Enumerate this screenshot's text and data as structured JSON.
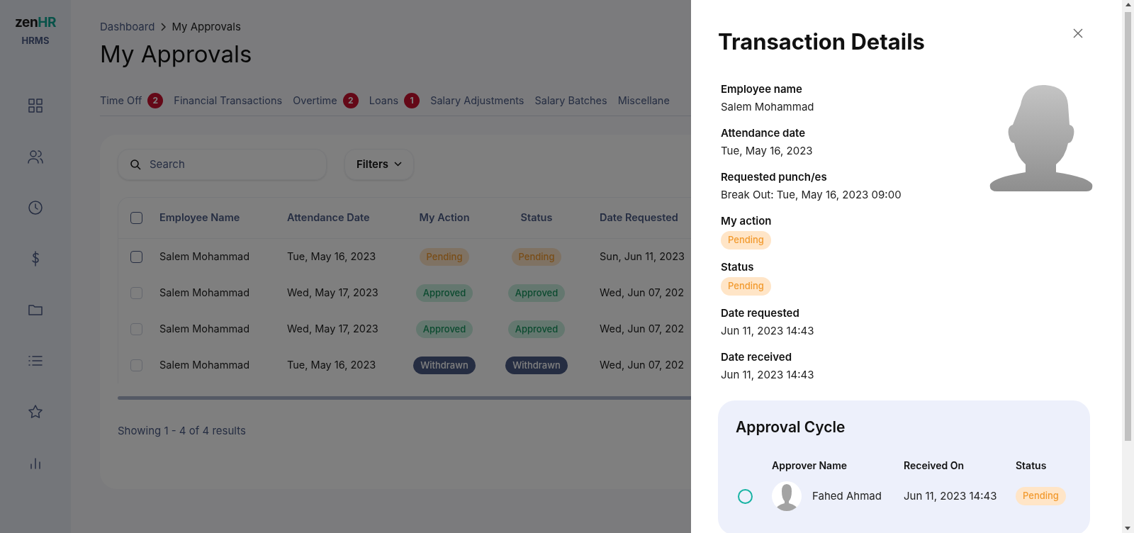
{
  "logo": {
    "brand_left": "zen",
    "brand_right": "HR",
    "product": "HRMS"
  },
  "sidebar": {
    "items": [
      {
        "kind": "grid"
      },
      {
        "kind": "users"
      },
      {
        "kind": "clock"
      },
      {
        "kind": "dollar"
      },
      {
        "kind": "folder"
      },
      {
        "kind": "list"
      },
      {
        "kind": "star"
      },
      {
        "kind": "chart"
      }
    ]
  },
  "breadcrumb": [
    "Dashboard",
    "My Approvals"
  ],
  "title": "My Approvals",
  "tabs": [
    {
      "label": "Time Off",
      "count": "2",
      "selected": false
    },
    {
      "label": "Financial Transactions",
      "selected": false
    },
    {
      "label": "Overtime",
      "count": "2",
      "selected": false
    },
    {
      "label": "Loans",
      "count": "1",
      "selected": false
    },
    {
      "label": "Salary Adjustments",
      "selected": false
    },
    {
      "label": "Salary Batches",
      "selected": false
    },
    {
      "label": "Miscellane",
      "selected": false
    }
  ],
  "search": {
    "placeholder": "Search"
  },
  "filters_button": "Filters",
  "table": {
    "select_all_checked": false,
    "columns": [
      "Employee Name",
      "Attendance Date",
      "My Action",
      "Status",
      "Date Requested"
    ],
    "rows": [
      {
        "disabled": false,
        "checked": false,
        "employee": "Salem Mohammad",
        "date": "Tue, May 16, 2023",
        "my_action": {
          "kind": "pending",
          "label": "Pending"
        },
        "status": {
          "kind": "pending",
          "label": "Pending"
        },
        "requested": "Sun, Jun 11, 2023"
      },
      {
        "disabled": true,
        "checked": false,
        "employee": "Salem Mohammad",
        "date": "Wed, May 17, 2023",
        "my_action": {
          "kind": "approved",
          "label": "Approved"
        },
        "status": {
          "kind": "approved",
          "label": "Approved"
        },
        "requested": "Wed, Jun 07, 202"
      },
      {
        "disabled": true,
        "checked": false,
        "employee": "Salem Mohammad",
        "date": "Wed, May 17, 2023",
        "my_action": {
          "kind": "approved",
          "label": "Approved"
        },
        "status": {
          "kind": "approved",
          "label": "Approved"
        },
        "requested": "Wed, Jun 07, 202"
      },
      {
        "disabled": true,
        "checked": false,
        "employee": "Salem Mohammad",
        "date": "Tue, May 16, 2023",
        "my_action": {
          "kind": "withdrawn",
          "label": "Withdrawn"
        },
        "status": {
          "kind": "withdrawn",
          "label": "Withdrawn"
        },
        "requested": "Wed, Jun 07, 202"
      }
    ]
  },
  "results": "Showing 1 - 4 of 4 results",
  "panel": {
    "title": "Transaction Details",
    "fields": [
      {
        "kind": "text",
        "label": "Employee name",
        "value": "Salem Mohammad"
      },
      {
        "kind": "text",
        "label": "Attendance date",
        "value": "Tue, May 16, 2023"
      },
      {
        "kind": "text",
        "label": "Requested punch/es",
        "value": "Break Out: Tue, May 16, 2023 09:00"
      },
      {
        "kind": "badge",
        "label": "My action",
        "badge": {
          "kind": "pending",
          "label": "Pending"
        }
      },
      {
        "kind": "badge",
        "label": "Status",
        "badge": {
          "kind": "pending",
          "label": "Pending"
        }
      },
      {
        "kind": "text",
        "label": "Date requested",
        "value": "Jun 11, 2023 14:43"
      },
      {
        "kind": "text",
        "label": "Date received",
        "value": "Jun 11, 2023 14:43"
      }
    ],
    "approval_cycle": {
      "title": "Approval Cycle",
      "columns": [
        "Approver Name",
        "Received On",
        "Status"
      ],
      "rows": [
        {
          "done": false,
          "approver": "Fahed Ahmad",
          "received": "Jun 11, 2023 14:43",
          "status": {
            "kind": "pending",
            "label": "Pending"
          }
        }
      ]
    }
  }
}
